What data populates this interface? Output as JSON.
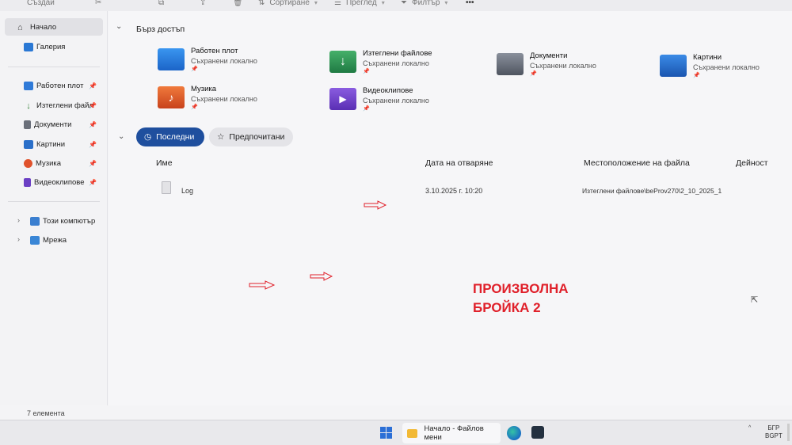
{
  "toolbar": {
    "create_label": "Създай",
    "sort_label": "Сортиране",
    "view_label": "Преглед",
    "filter_label": "Филтър",
    "more_label": "•••"
  },
  "sidebar": {
    "items": [
      {
        "label": "Начало"
      },
      {
        "label": "Галерия"
      },
      {
        "label": "Работен плот",
        "pinned": true
      },
      {
        "label": "Изтеглени файл",
        "pinned": true
      },
      {
        "label": "Документи",
        "pinned": true
      },
      {
        "label": "Картини",
        "pinned": true
      },
      {
        "label": "Музика",
        "pinned": true
      },
      {
        "label": "Видеоклипове",
        "pinned": true
      },
      {
        "label": "Този компютър"
      },
      {
        "label": "Мрежа"
      }
    ]
  },
  "quick_access": {
    "title": "Бърз достъп",
    "items": [
      {
        "name": "Работен плот",
        "sub": "Съхранени локално"
      },
      {
        "name": "Изтеглени файлове",
        "sub": "Съхранени локално"
      },
      {
        "name": "Документи",
        "sub": "Съхранени локално"
      },
      {
        "name": "Картини",
        "sub": "Съхранени локално"
      },
      {
        "name": "Музика",
        "sub": "Съхранени локално"
      },
      {
        "name": "Видеоклипове",
        "sub": "Съхранени локално"
      }
    ]
  },
  "tabs": {
    "recent": "Последни",
    "favorites": "Предпочитани"
  },
  "columns": {
    "name": "Име",
    "date": "Дата на отваряне",
    "location": "Местоположение на файла",
    "activity": "Дейност"
  },
  "rows": [
    {
      "name": "Log",
      "date": "3.10.2025 г. 10:20",
      "location": "Изтеглени файлове\\beProv270\\2_10_2025_1"
    }
  ],
  "annotation": {
    "line1": "ПРОИЗВОЛНА",
    "line2": "БРОЙКА 2"
  },
  "status": {
    "count": "7 елемента"
  },
  "taskbar": {
    "app_label": "Начало - Файлов мени",
    "lang_line1": "БГР",
    "lang_line2": "BGPT",
    "tray_chevron": "^"
  },
  "colors": {
    "accent": "#1f4f9e",
    "annotation": "#e0202a"
  }
}
